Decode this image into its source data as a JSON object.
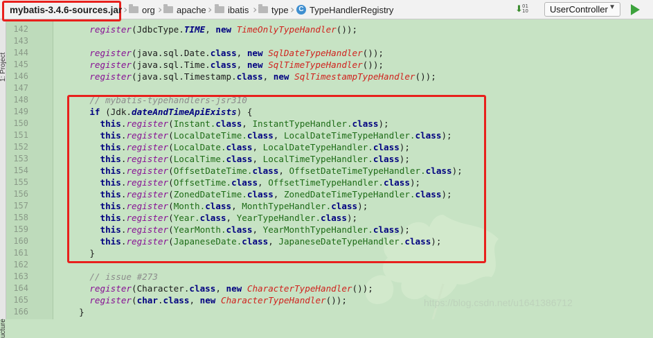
{
  "breadcrumb": {
    "jar": "mybatis-3.4.6-sources.jar",
    "items": [
      "org",
      "apache",
      "ibatis",
      "type"
    ],
    "current_class": "TypeHandlerRegistry",
    "class_icon": "class-c-icon"
  },
  "toolbar": {
    "sort_digits_top": "01",
    "sort_digits_bottom": "10",
    "run_config": "UserController"
  },
  "sidebar": {
    "top_label": "1: Project",
    "bottom_label": "ucture"
  },
  "watermark": "https://blog.csdn.net/u1641386712",
  "colors": {
    "highlight_border": "#e8201c",
    "background": "#c7e3c4",
    "keyword": "#000080",
    "method": "#871094",
    "type": "#d0231e"
  },
  "code": {
    "lines": [
      {
        "n": "142",
        "segs": [
          [
            "    ",
            ""
          ],
          [
            "register",
            "m"
          ],
          [
            "(JdbcType.",
            ""
          ],
          [
            "TIME",
            "s2"
          ],
          [
            ", ",
            ""
          ],
          [
            "new ",
            "k"
          ],
          [
            "TimeOnlyTypeHandler",
            "t"
          ],
          [
            "());",
            ""
          ]
        ]
      },
      {
        "n": "143",
        "segs": []
      },
      {
        "n": "144",
        "segs": [
          [
            "    ",
            ""
          ],
          [
            "register",
            "m"
          ],
          [
            "(java.sql.Date.",
            ""
          ],
          [
            "class",
            "k"
          ],
          [
            ", ",
            ""
          ],
          [
            "new ",
            "k"
          ],
          [
            "SqlDateTypeHandler",
            "t"
          ],
          [
            "());",
            ""
          ]
        ]
      },
      {
        "n": "145",
        "segs": [
          [
            "    ",
            ""
          ],
          [
            "register",
            "m"
          ],
          [
            "(java.sql.Time.",
            ""
          ],
          [
            "class",
            "k"
          ],
          [
            ", ",
            ""
          ],
          [
            "new ",
            "k"
          ],
          [
            "SqlTimeTypeHandler",
            "t"
          ],
          [
            "());",
            ""
          ]
        ]
      },
      {
        "n": "146",
        "segs": [
          [
            "    ",
            ""
          ],
          [
            "register",
            "m"
          ],
          [
            "(java.sql.Timestamp.",
            ""
          ],
          [
            "class",
            "k"
          ],
          [
            ", ",
            ""
          ],
          [
            "new ",
            "k"
          ],
          [
            "SqlTimestampTypeHandler",
            "t"
          ],
          [
            "());",
            ""
          ]
        ]
      },
      {
        "n": "147",
        "segs": []
      },
      {
        "n": "148",
        "segs": [
          [
            "    ",
            ""
          ],
          [
            "// mybatis-typehandlers-jsr310",
            "c"
          ]
        ]
      },
      {
        "n": "149",
        "segs": [
          [
            "    ",
            ""
          ],
          [
            "if ",
            "k"
          ],
          [
            "(Jdk.",
            ""
          ],
          [
            "dateAndTimeApiExists",
            "s2"
          ],
          [
            ") {",
            ""
          ]
        ]
      },
      {
        "n": "150",
        "segs": [
          [
            "      ",
            ""
          ],
          [
            "this",
            "k"
          ],
          [
            ".",
            ""
          ],
          [
            "register",
            "m"
          ],
          [
            "(",
            ""
          ],
          [
            "Instant.",
            "g"
          ],
          [
            "class",
            "k"
          ],
          [
            ", ",
            ""
          ],
          [
            "InstantTypeHandler.",
            "g"
          ],
          [
            "class",
            "k"
          ],
          [
            ");",
            ""
          ]
        ]
      },
      {
        "n": "151",
        "segs": [
          [
            "      ",
            ""
          ],
          [
            "this",
            "k"
          ],
          [
            ".",
            ""
          ],
          [
            "register",
            "m"
          ],
          [
            "(",
            ""
          ],
          [
            "LocalDateTime.",
            "g"
          ],
          [
            "class",
            "k"
          ],
          [
            ", ",
            ""
          ],
          [
            "LocalDateTimeTypeHandler.",
            "g"
          ],
          [
            "class",
            "k"
          ],
          [
            ");",
            ""
          ]
        ]
      },
      {
        "n": "152",
        "segs": [
          [
            "      ",
            ""
          ],
          [
            "this",
            "k"
          ],
          [
            ".",
            ""
          ],
          [
            "register",
            "m"
          ],
          [
            "(",
            ""
          ],
          [
            "LocalDate.",
            "g"
          ],
          [
            "class",
            "k"
          ],
          [
            ", ",
            ""
          ],
          [
            "LocalDateTypeHandler.",
            "g"
          ],
          [
            "class",
            "k"
          ],
          [
            ");",
            ""
          ]
        ]
      },
      {
        "n": "153",
        "segs": [
          [
            "      ",
            ""
          ],
          [
            "this",
            "k"
          ],
          [
            ".",
            ""
          ],
          [
            "register",
            "m"
          ],
          [
            "(",
            ""
          ],
          [
            "LocalTime.",
            "g"
          ],
          [
            "class",
            "k"
          ],
          [
            ", ",
            ""
          ],
          [
            "LocalTimeTypeHandler.",
            "g"
          ],
          [
            "class",
            "k"
          ],
          [
            ");",
            ""
          ]
        ]
      },
      {
        "n": "154",
        "segs": [
          [
            "      ",
            ""
          ],
          [
            "this",
            "k"
          ],
          [
            ".",
            ""
          ],
          [
            "register",
            "m"
          ],
          [
            "(",
            ""
          ],
          [
            "OffsetDateTime.",
            "g"
          ],
          [
            "class",
            "k"
          ],
          [
            ", ",
            ""
          ],
          [
            "OffsetDateTimeTypeHandler.",
            "g"
          ],
          [
            "class",
            "k"
          ],
          [
            ");",
            ""
          ]
        ]
      },
      {
        "n": "155",
        "segs": [
          [
            "      ",
            ""
          ],
          [
            "this",
            "k"
          ],
          [
            ".",
            ""
          ],
          [
            "register",
            "m"
          ],
          [
            "(",
            ""
          ],
          [
            "OffsetTime.",
            "g"
          ],
          [
            "class",
            "k"
          ],
          [
            ", ",
            ""
          ],
          [
            "OffsetTimeTypeHandler.",
            "g"
          ],
          [
            "class",
            "k"
          ],
          [
            ");",
            ""
          ]
        ]
      },
      {
        "n": "156",
        "segs": [
          [
            "      ",
            ""
          ],
          [
            "this",
            "k"
          ],
          [
            ".",
            ""
          ],
          [
            "register",
            "m"
          ],
          [
            "(",
            ""
          ],
          [
            "ZonedDateTime.",
            "g"
          ],
          [
            "class",
            "k"
          ],
          [
            ", ",
            ""
          ],
          [
            "ZonedDateTimeTypeHandler.",
            "g"
          ],
          [
            "class",
            "k"
          ],
          [
            ");",
            ""
          ]
        ]
      },
      {
        "n": "157",
        "segs": [
          [
            "      ",
            ""
          ],
          [
            "this",
            "k"
          ],
          [
            ".",
            ""
          ],
          [
            "register",
            "m"
          ],
          [
            "(",
            ""
          ],
          [
            "Month.",
            "g"
          ],
          [
            "class",
            "k"
          ],
          [
            ", ",
            ""
          ],
          [
            "MonthTypeHandler.",
            "g"
          ],
          [
            "class",
            "k"
          ],
          [
            ");",
            ""
          ]
        ]
      },
      {
        "n": "158",
        "segs": [
          [
            "      ",
            ""
          ],
          [
            "this",
            "k"
          ],
          [
            ".",
            ""
          ],
          [
            "register",
            "m"
          ],
          [
            "(",
            ""
          ],
          [
            "Year.",
            "g"
          ],
          [
            "class",
            "k"
          ],
          [
            ", ",
            ""
          ],
          [
            "YearTypeHandler.",
            "g"
          ],
          [
            "class",
            "k"
          ],
          [
            ");",
            ""
          ]
        ]
      },
      {
        "n": "159",
        "segs": [
          [
            "      ",
            ""
          ],
          [
            "this",
            "k"
          ],
          [
            ".",
            ""
          ],
          [
            "register",
            "m"
          ],
          [
            "(",
            ""
          ],
          [
            "YearMonth.",
            "g"
          ],
          [
            "class",
            "k"
          ],
          [
            ", ",
            ""
          ],
          [
            "YearMonthTypeHandler.",
            "g"
          ],
          [
            "class",
            "k"
          ],
          [
            ");",
            ""
          ]
        ]
      },
      {
        "n": "160",
        "segs": [
          [
            "      ",
            ""
          ],
          [
            "this",
            "k"
          ],
          [
            ".",
            ""
          ],
          [
            "register",
            "m"
          ],
          [
            "(",
            ""
          ],
          [
            "JapaneseDate.",
            "g"
          ],
          [
            "class",
            "k"
          ],
          [
            ", ",
            ""
          ],
          [
            "JapaneseDateTypeHandler.",
            "g"
          ],
          [
            "class",
            "k"
          ],
          [
            ");",
            ""
          ]
        ]
      },
      {
        "n": "161",
        "segs": [
          [
            "    }",
            ""
          ]
        ]
      },
      {
        "n": "162",
        "segs": []
      },
      {
        "n": "163",
        "segs": [
          [
            "    ",
            ""
          ],
          [
            "// issue #273",
            "c"
          ]
        ]
      },
      {
        "n": "164",
        "segs": [
          [
            "    ",
            ""
          ],
          [
            "register",
            "m"
          ],
          [
            "(Character.",
            ""
          ],
          [
            "class",
            "k"
          ],
          [
            ", ",
            ""
          ],
          [
            "new ",
            "k"
          ],
          [
            "CharacterTypeHandler",
            "t"
          ],
          [
            "());",
            ""
          ]
        ]
      },
      {
        "n": "165",
        "segs": [
          [
            "    ",
            ""
          ],
          [
            "register",
            "m"
          ],
          [
            "(",
            ""
          ],
          [
            "char",
            "k"
          ],
          [
            ".",
            ""
          ],
          [
            "class",
            "k"
          ],
          [
            ", ",
            ""
          ],
          [
            "new ",
            "k"
          ],
          [
            "CharacterTypeHandler",
            "t"
          ],
          [
            "());",
            ""
          ]
        ]
      },
      {
        "n": "166",
        "segs": [
          [
            "  }",
            ""
          ]
        ]
      }
    ]
  }
}
